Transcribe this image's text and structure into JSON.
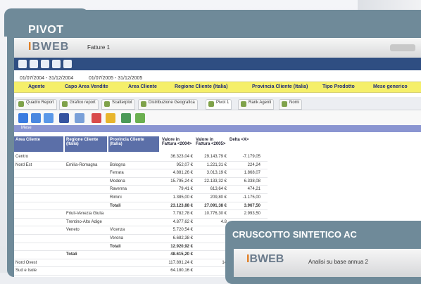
{
  "frame": {
    "title": "PIVOT"
  },
  "app": {
    "logo_prefix": "I",
    "logo_text": "BWEB",
    "tab_name": "Fatture 1"
  },
  "dates": {
    "period1": "01/07/2004 - 31/12/2004",
    "period2": "01/07/2005 - 31/12/2005"
  },
  "filters": [
    "Agente",
    "Capo Area Vendite",
    "Area Cliente",
    "Regione Cliente (Italia)",
    "Provincia Cliente (Italia)",
    "Tipo Prodotto",
    "Mese generico"
  ],
  "tabs": [
    "Quadro Report",
    "Grafico report",
    "Scatterplot",
    "Distribuzione Geografica",
    "Pivot 1",
    "Rank Agenti",
    "Nomi"
  ],
  "mese_label": "Mese",
  "grid": {
    "headers": [
      "Area Cliente",
      "Regione Cliente (Italia)",
      "Provincia Cliente (Italia)",
      "Valore in Fattura <2004>",
      "Valore in Fattura <2005>",
      "Delta <X>"
    ],
    "rows": [
      {
        "c1": "Centro",
        "c2": "",
        "c3": "",
        "v1": "36.323,04 €",
        "v2": "29.143,79 €",
        "d": "-7.179,05"
      },
      {
        "c1": "Nord Est",
        "c2": "Emilia-Romagna",
        "c3": "Bologna",
        "v1": "952,07 €",
        "v2": "1.221,31 €",
        "d": "224,24"
      },
      {
        "c1": "",
        "c2": "",
        "c3": "Ferrara",
        "v1": "4.881,26 €",
        "v2": "3.013,19 €",
        "d": "1.868,07"
      },
      {
        "c1": "",
        "c2": "",
        "c3": "Modena",
        "v1": "15.795,24 €",
        "v2": "22.133,32 €",
        "d": "6.338,08"
      },
      {
        "c1": "",
        "c2": "",
        "c3": "Ravenna",
        "v1": "79,41 €",
        "v2": "613,64 €",
        "d": "474,21"
      },
      {
        "c1": "",
        "c2": "",
        "c3": "Rimini",
        "v1": "1.385,00 €",
        "v2": "209,80 €",
        "d": "-1.175,00"
      },
      {
        "c1": "",
        "c2": "",
        "c3": "Totali",
        "v1": "23.123,88 €",
        "v2": "27.091,38 €",
        "d": "3.967,50"
      },
      {
        "c1": "",
        "c2": "Friuli-Venezia Giulia",
        "c3": "",
        "v1": "7.782,78 €",
        "v2": "10.776,30 €",
        "d": "2.993,50"
      },
      {
        "c1": "",
        "c2": "Trentino-Alto Adige",
        "c3": "",
        "v1": "4.877,62 €",
        "v2": "4.8",
        "d": ""
      },
      {
        "c1": "",
        "c2": "Veneto",
        "c3": "Vicenza",
        "v1": "5.720,54 €",
        "v2": "",
        "d": ""
      },
      {
        "c1": "",
        "c2": "",
        "c3": "Verona",
        "v1": "6.682,38 €",
        "v2": "",
        "d": ""
      },
      {
        "c1": "",
        "c2": "",
        "c3": "Totali",
        "v1": "12.920,92 €",
        "v2": "",
        "d": ""
      },
      {
        "c1": "",
        "c2": "Totali",
        "c3": "",
        "v1": "48.615,20 €",
        "v2": "",
        "d": ""
      },
      {
        "c1": "Nord Ovest",
        "c2": "",
        "c3": "",
        "v1": "117.891,24 €",
        "v2": "14",
        "d": ""
      },
      {
        "c1": "Sud e Isole",
        "c2": "",
        "c3": "",
        "v1": "64.180,16 €",
        "v2": "",
        "d": ""
      },
      {
        "c1": "Totali",
        "c2": "",
        "c3": "",
        "v1": "267.155,61 €",
        "v2": "28",
        "d": ""
      }
    ]
  },
  "popup": {
    "title": "CRUSCOTTO SINTETICO AC",
    "logo_prefix": "I",
    "logo_text": "BWEB",
    "text": "Analisi su base annua 2"
  }
}
